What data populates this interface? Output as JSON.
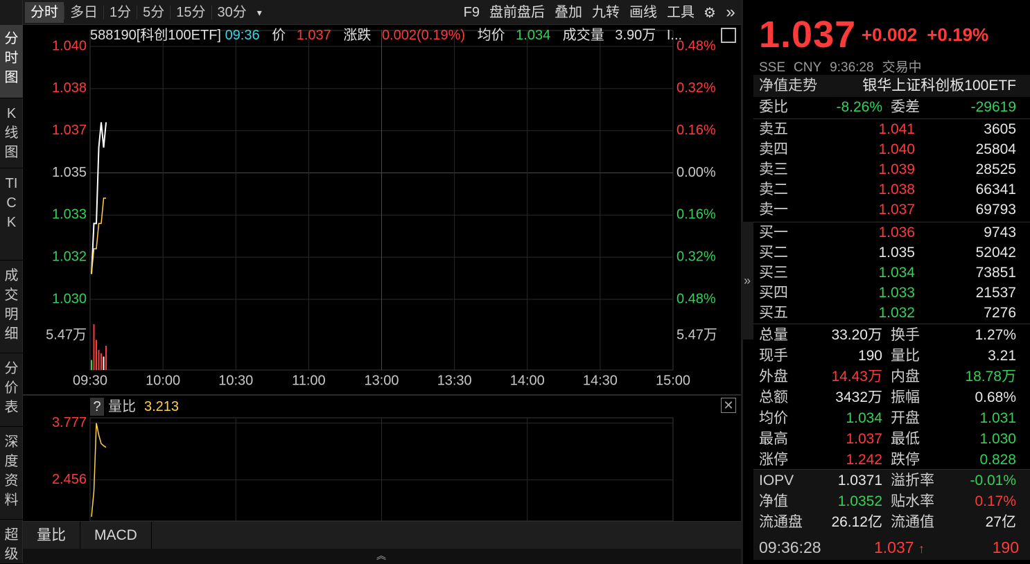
{
  "leftnav": [
    {
      "label": "分时图",
      "active": true
    },
    {
      "label": "K线图",
      "active": false
    },
    {
      "label": "TICK",
      "active": false
    },
    {
      "label": "成交明细",
      "active": false
    },
    {
      "label": "分价表",
      "active": false
    },
    {
      "label": "深度资料",
      "active": false
    },
    {
      "label": "超级",
      "active": false
    }
  ],
  "toolbar": {
    "tabs": [
      "分时",
      "多日",
      "1分",
      "5分",
      "15分",
      "30分"
    ],
    "more_icon": "dropdown-caret-icon",
    "buttons": [
      "F9",
      "盘前盘后",
      "叠加",
      "九转",
      "画线",
      "工具"
    ],
    "settings_icon": "gear-icon",
    "expand_icon": "double-chevron-right-icon"
  },
  "infoline": {
    "code": "588190[科创100ETF]",
    "time": "09:36",
    "price_label": "价",
    "price": "1.037",
    "change_label": "涨跌",
    "change": "0.002(0.19%)",
    "avg_label": "均价",
    "avg": "1.034",
    "volume_label": "成交量",
    "volume": "3.90万",
    "more": "I..."
  },
  "chart_data": [
    {
      "type": "line",
      "title": "",
      "x_ticks": [
        "09:30",
        "10:00",
        "10:30",
        "11:00",
        "13:00",
        "13:30",
        "14:00",
        "14:30",
        "15:00"
      ],
      "y_left_ticks": [
        "1.040",
        "1.038",
        "1.037",
        "1.035",
        "1.033",
        "1.032",
        "1.030"
      ],
      "y_right_ticks": [
        "0.48%",
        "0.32%",
        "0.16%",
        "0.00%",
        "0.16%",
        "0.32%",
        "0.48%"
      ],
      "ylim": [
        1.03,
        1.04
      ],
      "series": [
        {
          "name": "价",
          "x": [
            "09:30",
            "09:31",
            "09:32",
            "09:33",
            "09:34",
            "09:35",
            "09:36"
          ],
          "values": [
            1.031,
            1.033,
            1.033,
            1.036,
            1.037,
            1.036,
            1.037
          ],
          "color": "#ffffff"
        },
        {
          "name": "均价",
          "x": [
            "09:30",
            "09:31",
            "09:32",
            "09:33",
            "09:34",
            "09:35",
            "09:36"
          ],
          "values": [
            1.031,
            1.032,
            1.032,
            1.033,
            1.033,
            1.034,
            1.034
          ],
          "color": "#ffd24a"
        }
      ],
      "volume": {
        "max_label": "5.47万",
        "bars": [
          {
            "x": "09:30",
            "value": 1.2,
            "color": "#34d058"
          },
          {
            "x": "09:31",
            "value": 5.47,
            "color": "#ff3a3a"
          },
          {
            "x": "09:32",
            "value": 3.6,
            "color": "#ff3a3a"
          },
          {
            "x": "09:33",
            "value": 2.4,
            "color": "#ff3a3a"
          },
          {
            "x": "09:34",
            "value": 2.0,
            "color": "#ff3a3a"
          },
          {
            "x": "09:35",
            "value": 1.6,
            "color": "#ffffff"
          },
          {
            "x": "09:36",
            "value": 2.9,
            "color": "#ff3a3a"
          }
        ]
      }
    },
    {
      "type": "line",
      "title": "量比",
      "current": "3.213",
      "y_ticks": [
        "3.777",
        "2.456"
      ],
      "ylim": [
        1.5,
        3.9
      ],
      "series": [
        {
          "name": "量比",
          "x": [
            "09:30",
            "09:31",
            "09:32",
            "09:33",
            "09:34",
            "09:35",
            "09:36"
          ],
          "values": [
            1.6,
            2.2,
            3.777,
            3.5,
            3.3,
            3.25,
            3.213
          ],
          "color": "#ffd24a"
        }
      ]
    }
  ],
  "bottomtabs": [
    "量比",
    "MACD"
  ],
  "quote": {
    "price": "1.037",
    "change": "+0.002",
    "change_pct": "+0.19%",
    "exchange": "SSE",
    "currency": "CNY",
    "time": "9:36:28",
    "status": "交易中",
    "nav_trend_label": "净值走势",
    "fund_name": "银华上证科创板100ETF",
    "weibi_label": "委比",
    "weibi": "-8.26%",
    "weicha_label": "委差",
    "weicha": "-29619"
  },
  "orderbook": {
    "asks": [
      {
        "name": "卖五",
        "price": "1.041",
        "vol": "3605",
        "color": "red"
      },
      {
        "name": "卖四",
        "price": "1.040",
        "vol": "25804",
        "color": "red"
      },
      {
        "name": "卖三",
        "price": "1.039",
        "vol": "28525",
        "color": "red"
      },
      {
        "name": "卖二",
        "price": "1.038",
        "vol": "66341",
        "color": "red"
      },
      {
        "name": "卖一",
        "price": "1.037",
        "vol": "69793",
        "color": "red"
      }
    ],
    "bids": [
      {
        "name": "买一",
        "price": "1.036",
        "vol": "9743",
        "color": "red"
      },
      {
        "name": "买二",
        "price": "1.035",
        "vol": "52042",
        "color": "white"
      },
      {
        "name": "买三",
        "price": "1.034",
        "vol": "73851",
        "color": "green"
      },
      {
        "name": "买四",
        "price": "1.033",
        "vol": "21537",
        "color": "green"
      },
      {
        "name": "买五",
        "price": "1.032",
        "vol": "7276",
        "color": "green"
      }
    ]
  },
  "stats": [
    {
      "l1": "总量",
      "v1": "33.20万",
      "c1": "white",
      "l2": "换手",
      "v2": "1.27%",
      "c2": "white"
    },
    {
      "l1": "现手",
      "v1": "190",
      "c1": "white",
      "l2": "量比",
      "v2": "3.21",
      "c2": "white"
    },
    {
      "l1": "外盘",
      "v1": "14.43万",
      "c1": "red",
      "l2": "内盘",
      "v2": "18.78万",
      "c2": "green"
    },
    {
      "l1": "总额",
      "v1": "3432万",
      "c1": "white",
      "l2": "振幅",
      "v2": "0.68%",
      "c2": "white"
    },
    {
      "l1": "均价",
      "v1": "1.034",
      "c1": "green",
      "l2": "开盘",
      "v2": "1.031",
      "c2": "green"
    },
    {
      "l1": "最高",
      "v1": "1.037",
      "c1": "red",
      "l2": "最低",
      "v2": "1.030",
      "c2": "green"
    },
    {
      "l1": "涨停",
      "v1": "1.242",
      "c1": "red",
      "l2": "跌停",
      "v2": "0.828",
      "c2": "green"
    }
  ],
  "etf_stats": [
    {
      "l1": "IOPV",
      "v1": "1.0371",
      "c1": "white",
      "l2": "溢折率",
      "v2": "-0.01%",
      "c2": "green"
    },
    {
      "l1": "净值",
      "v1": "1.0352",
      "c1": "green",
      "l2": "贴水率",
      "v2": "0.17%",
      "c2": "red"
    },
    {
      "l1": "流通盘",
      "v1": "26.12亿",
      "c1": "white",
      "l2": "流通值",
      "v2": "27亿",
      "c2": "white"
    }
  ],
  "lasttick": {
    "time": "09:36:28",
    "price": "1.037",
    "arrow": "↑",
    "vol": "190"
  }
}
